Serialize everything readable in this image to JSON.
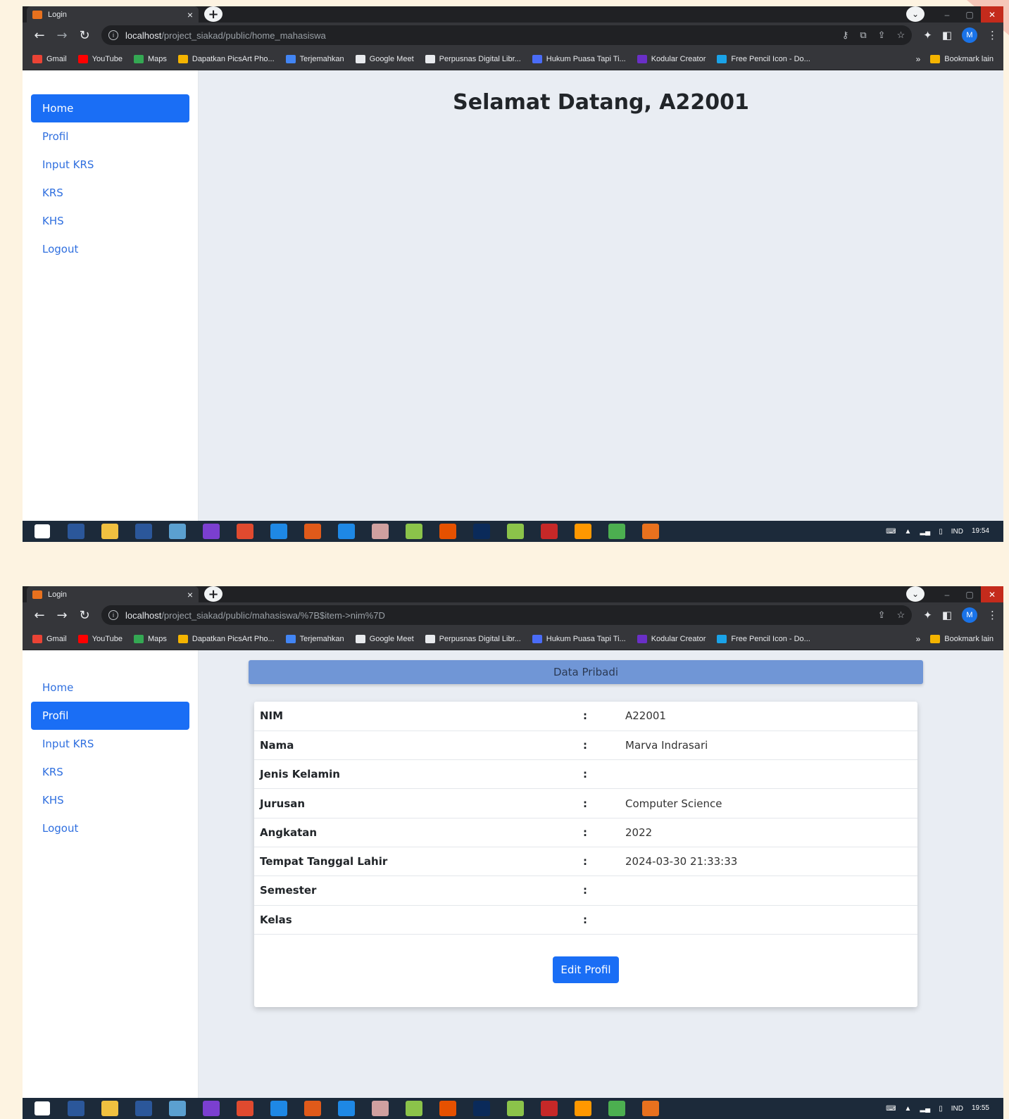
{
  "browser": {
    "tab_title": "Login",
    "tab_close": "×",
    "new_tab": "+",
    "tab_search": "⌄",
    "win_min": "–",
    "win_max": "▢",
    "win_close": "✕",
    "bookmarks": [
      {
        "label": "Gmail",
        "color": "#ea4335"
      },
      {
        "label": "YouTube",
        "color": "#ff0000"
      },
      {
        "label": "Maps",
        "color": "#34a853"
      },
      {
        "label": "Dapatkan PicsArt Pho...",
        "color": "#f4b400"
      },
      {
        "label": "Terjemahkan",
        "color": "#4285f4"
      },
      {
        "label": "Google Meet",
        "color": "#e8eaed"
      },
      {
        "label": "Perpusnas Digital Libr...",
        "color": "#e8eaed"
      },
      {
        "label": "Hukum Puasa Tapi Ti...",
        "color": "#4a6cf7"
      },
      {
        "label": "Kodular Creator",
        "color": "#6a2fc7"
      },
      {
        "label": "Free Pencil Icon - Do...",
        "color": "#1aa3e8"
      }
    ],
    "bookmarks_more": "»",
    "other_bookmarks": "Bookmark lain",
    "avatar_letter": "M"
  },
  "shot1": {
    "url_host": "localhost",
    "url_path": "/project_siakad/public/home_mahasiswa",
    "welcome": "Selamat Datang, A22001",
    "clock_time": "19:54"
  },
  "shot2": {
    "url_host": "localhost",
    "url_path": "/project_siakad/public/mahasiswa/%7B$item->nim%7D",
    "card_title": "Data Pribadi",
    "rows": [
      {
        "label": "NIM",
        "sep": ":",
        "value": "A22001"
      },
      {
        "label": "Nama",
        "sep": ":",
        "value": "Marva Indrasari"
      },
      {
        "label": "Jenis Kelamin",
        "sep": ":",
        "value": ""
      },
      {
        "label": "Jurusan",
        "sep": ":",
        "value": "Computer Science"
      },
      {
        "label": "Angkatan",
        "sep": ":",
        "value": "2022"
      },
      {
        "label": "Tempat Tanggal Lahir",
        "sep": ":",
        "value": "2024-03-30 21:33:33"
      },
      {
        "label": "Semester",
        "sep": ":",
        "value": ""
      },
      {
        "label": "Kelas",
        "sep": ":",
        "value": ""
      }
    ],
    "edit_button": "Edit Profil",
    "clock_time": "19:55"
  },
  "sidebar": {
    "items": [
      "Home",
      "Profil",
      "Input KRS",
      "KRS",
      "KHS",
      "Logout"
    ]
  },
  "taskbar": {
    "lang": "IND",
    "apps": [
      "#2b579a",
      "#f0c040",
      "#2b579a",
      "#5ba0d0",
      "#7b3fd0",
      "#e04a2f",
      "#1e88e5",
      "#e05a1a",
      "#1e88e5",
      "#d0a0a0",
      "#8bc34a",
      "#e65100",
      "#0a2a5a",
      "#8bc34a",
      "#c62828",
      "#ff9800",
      "#4caf50",
      "#e8711e"
    ]
  },
  "colors": {
    "accent": "#1a6ef5",
    "card_header": "#7096d6",
    "background": "#fdf3e1"
  }
}
